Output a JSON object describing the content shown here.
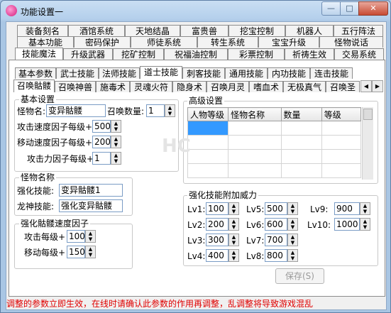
{
  "window": {
    "title": "功能设置一",
    "min_glyph": "—",
    "max_glyph": "□",
    "close_glyph": "✕"
  },
  "tabs_row1": [
    "装备刻名",
    "酒馆系统",
    "天地结晶",
    "富贵兽",
    "挖宝控制",
    "机器人",
    "五行阵法"
  ],
  "tabs_row2": [
    "基本功能",
    "密码保护",
    "师徒系统",
    "转生系统",
    "宝宝升级",
    "怪物说话"
  ],
  "tabs_row3": [
    "技能魔法",
    "升级武器",
    "挖矿控制",
    "祝福油控制",
    "彩票控制",
    "祈祷生效",
    "交易系统"
  ],
  "sub_tabs": [
    "基本参数",
    "武士技能",
    "法师技能",
    "道士技能",
    "刺客技能",
    "通用技能",
    "内功技能",
    "连击技能"
  ],
  "sub_tabs_selected": "道士技能",
  "skill_tabs": [
    "召唤骷髅",
    "召唤神兽",
    "施毒术",
    "灵魂火符",
    "隐身术",
    "召唤月灵",
    "嗜血术",
    "无极真气",
    "召唤圣"
  ],
  "skill_tabs_selected": "召唤骷髅",
  "scroll_left": "◀",
  "scroll_right": "▶",
  "basic": {
    "group_title": "基本设置",
    "monster_name_label": "怪物名:",
    "monster_name_value": "变异骷髅",
    "summon_count_label": "召唤数量:",
    "summon_count_value": "1",
    "attack_speed_label": "攻击速度因子每级+",
    "attack_speed_value": "500",
    "move_speed_label": "移动速度因子每级+",
    "move_speed_value": "200",
    "attack_power_label": "攻击力因子每级+",
    "attack_power_value": "1"
  },
  "monster_name": {
    "group_title": "怪物名称",
    "enhance_label": "强化技能:",
    "enhance_value": "变异骷髅1",
    "dragon_label": "龙神技能:",
    "dragon_value": "强化变异骷髅"
  },
  "speed": {
    "group_title": "强化骷髅速度因子",
    "attack_label": "攻击每级+",
    "attack_value": "100",
    "move_label": "移动每级+",
    "move_value": "150"
  },
  "advanced": {
    "group_title": "高级设置",
    "columns": [
      "人物等级",
      "怪物名称",
      "数量",
      "等级"
    ]
  },
  "power": {
    "group_title": "强化技能附加威力",
    "levels": [
      {
        "label": "Lv1:",
        "value": "100"
      },
      {
        "label": "Lv2:",
        "value": "200"
      },
      {
        "label": "Lv3:",
        "value": "300"
      },
      {
        "label": "Lv4:",
        "value": "400"
      },
      {
        "label": "Lv5:",
        "value": "500"
      },
      {
        "label": "Lv6:",
        "value": "600"
      },
      {
        "label": "Lv7:",
        "value": "700"
      },
      {
        "label": "Lv8:",
        "value": "800"
      },
      {
        "label": "Lv9:",
        "value": "900"
      },
      {
        "label": "Lv10:",
        "value": "1000"
      }
    ]
  },
  "save_label": "保存(S)",
  "status_text": "调整的参数立即生效，在线时请确认此参数的作用再调整，乱调整将导致游戏混乱",
  "watermark": "HC",
  "colors": {
    "status": "#e00000",
    "selection": "#3399ff",
    "title_bg": "#b9d3ee"
  }
}
